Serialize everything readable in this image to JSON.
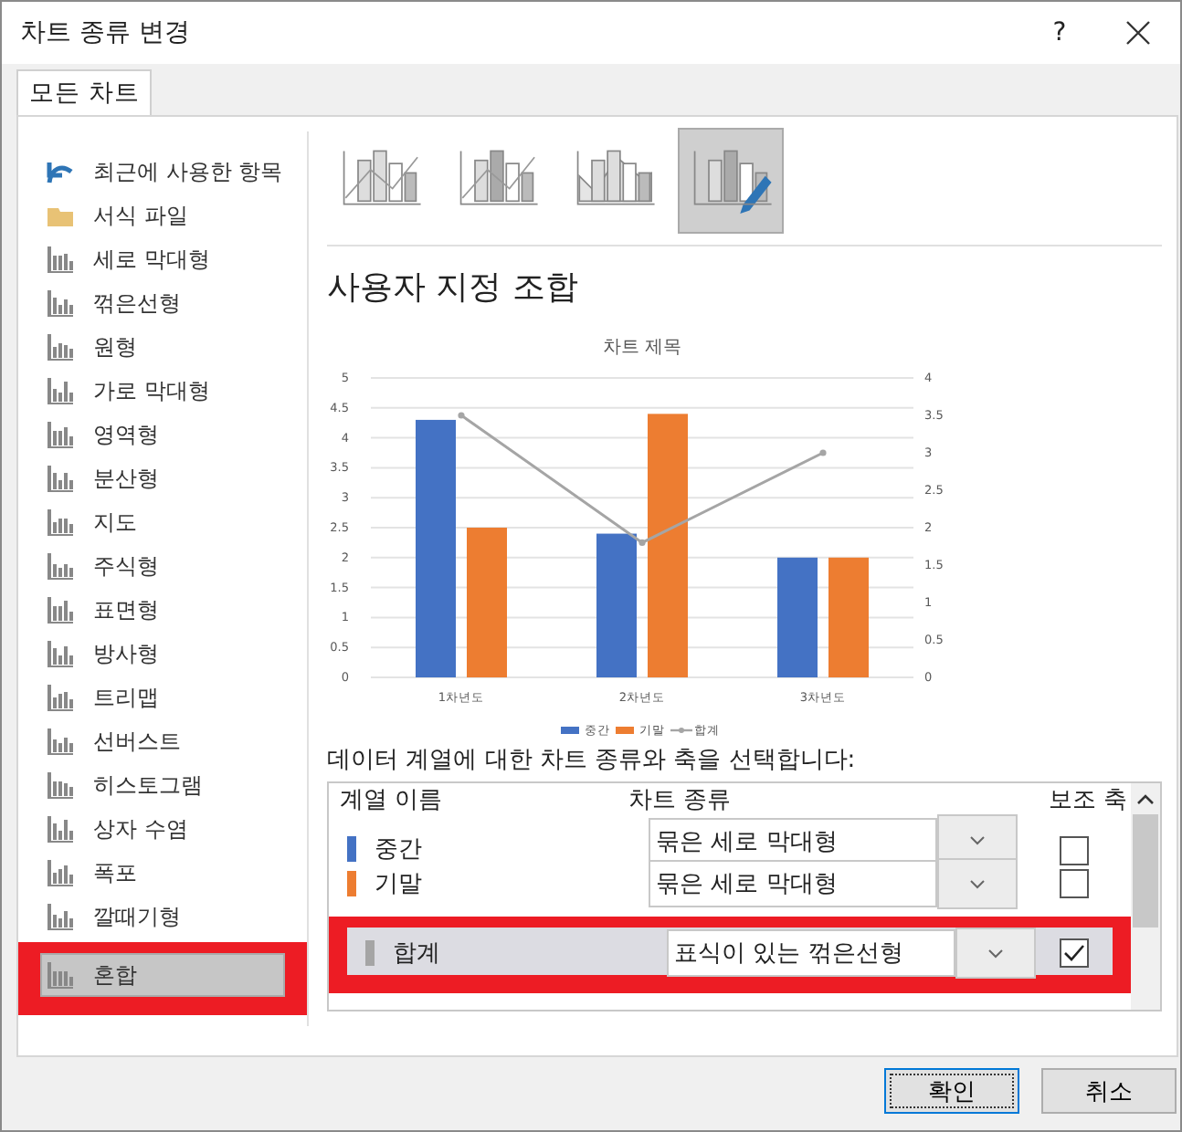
{
  "window": {
    "title": "차트 종류 변경",
    "help": "?"
  },
  "tabs": [
    {
      "label": "모든 차트",
      "selected": true
    }
  ],
  "sidebar": {
    "items": [
      {
        "label": "최근에 사용한 항목",
        "selected": false
      },
      {
        "label": "서식 파일",
        "selected": false
      },
      {
        "label": "세로 막대형",
        "selected": false
      },
      {
        "label": "꺾은선형",
        "selected": false
      },
      {
        "label": "원형",
        "selected": false
      },
      {
        "label": "가로 막대형",
        "selected": false
      },
      {
        "label": "영역형",
        "selected": false
      },
      {
        "label": "분산형",
        "selected": false
      },
      {
        "label": "지도",
        "selected": false
      },
      {
        "label": "주식형",
        "selected": false
      },
      {
        "label": "표면형",
        "selected": false
      },
      {
        "label": "방사형",
        "selected": false
      },
      {
        "label": "트리맵",
        "selected": false
      },
      {
        "label": "선버스트",
        "selected": false
      },
      {
        "label": "히스토그램",
        "selected": false
      },
      {
        "label": "상자 수염",
        "selected": false
      },
      {
        "label": "폭포",
        "selected": false
      },
      {
        "label": "깔때기형",
        "selected": false
      },
      {
        "label": "혼합",
        "selected": true
      }
    ]
  },
  "subtypes": [
    {
      "selected": false
    },
    {
      "selected": false
    },
    {
      "selected": false
    },
    {
      "selected": true
    }
  ],
  "heading": "사용자 지정 조합",
  "chart": {
    "chart_data": {
      "type": "bar",
      "title": "차트 제목",
      "categories": [
        "1차년도",
        "2차년도",
        "3차년도"
      ],
      "series": [
        {
          "name": "중간",
          "color": "#4472c4",
          "values": [
            4.3,
            2.4,
            2
          ]
        },
        {
          "name": "기말",
          "color": "#ed7d31",
          "values": [
            2.5,
            4.4,
            2
          ]
        },
        {
          "name": "합계",
          "color": "#a5a5a5",
          "values": [
            3.5,
            1.8,
            3
          ],
          "type": "line",
          "axis": "y2",
          "marker": "circle"
        }
      ],
      "grid": true,
      "legend": "bottom",
      "ylim": [
        0,
        5
      ],
      "yticks": [
        0,
        0.5,
        1,
        1.5,
        2,
        2.5,
        3,
        3.5,
        4,
        4.5,
        5
      ],
      "y2lim": [
        0,
        4
      ],
      "y2ticks": [
        0,
        0.5,
        1,
        1.5,
        2,
        2.5,
        3,
        3.5,
        4
      ]
    }
  },
  "instruction": "데이터 계열에 대한 차트 종류와 축을 선택합니다:",
  "table": {
    "columns": [
      "계열 이름",
      "차트 종류",
      "보조 축"
    ],
    "rows": [
      {
        "name": "중간",
        "color": "#4472c4",
        "chart_type": "묶은 세로 막대형",
        "secondary_axis": false,
        "selected": false
      },
      {
        "name": "기말",
        "color": "#ed7d31",
        "chart_type": "묶은 세로 막대형",
        "secondary_axis": false,
        "selected": false
      },
      {
        "name": "합계",
        "color": "#a5a5a5",
        "chart_type": "표식이 있는 꺾은선형",
        "secondary_axis": true,
        "selected": true
      }
    ]
  },
  "buttons": [
    {
      "label": "확인",
      "kind": "primary"
    },
    {
      "label": "취소",
      "kind": "normal"
    }
  ]
}
